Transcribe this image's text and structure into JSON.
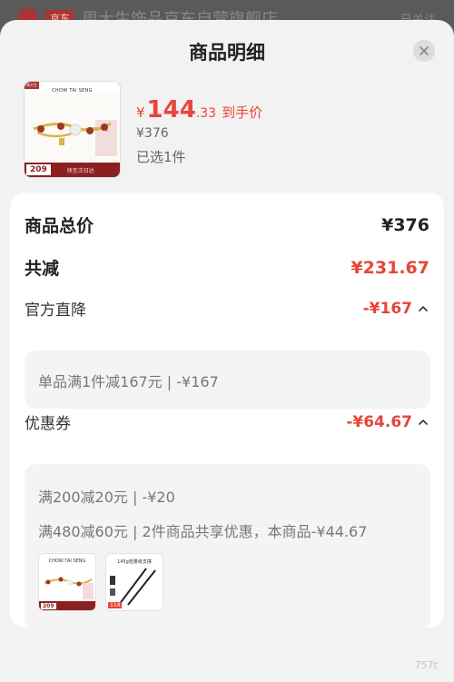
{
  "background": {
    "tag": "京东",
    "store_title": "周大生饰品京东自营旗舰店",
    "follow": "已关注"
  },
  "sheet": {
    "title": "商品明细"
  },
  "product": {
    "thumb_brand": "CHOW TAI SENG",
    "thumb_ribbon": "周大生",
    "thumb_price": "209",
    "thumb_slogan": "快至次日达",
    "price_symbol": "¥",
    "price_int": "144",
    "price_dec": ".33",
    "price_label": "到手价",
    "original_price": "¥376",
    "selected": "已选1件"
  },
  "summary": {
    "total_label": "商品总价",
    "total_value": "¥376",
    "reduce_label": "共减",
    "reduce_value": "¥231.67"
  },
  "official": {
    "label": "官方直降",
    "value": "-¥167",
    "detail": "单品满1件减167元 | -¥167"
  },
  "coupon": {
    "label": "优惠券",
    "value": "-¥64.67",
    "detail1": "满200减20元 | -¥20",
    "detail2": "满480减60元 | 2件商品共享优惠，本商品-¥44.67",
    "thumbs": [
      {
        "title": "CHOW TAI SENG",
        "price": "209"
      },
      {
        "title": "145g轻量级支撑",
        "price": "114"
      }
    ]
  },
  "colors": {
    "accent_red": "#e8453a",
    "sheet_bg": "#f2f2f2"
  },
  "watermark": "757t"
}
